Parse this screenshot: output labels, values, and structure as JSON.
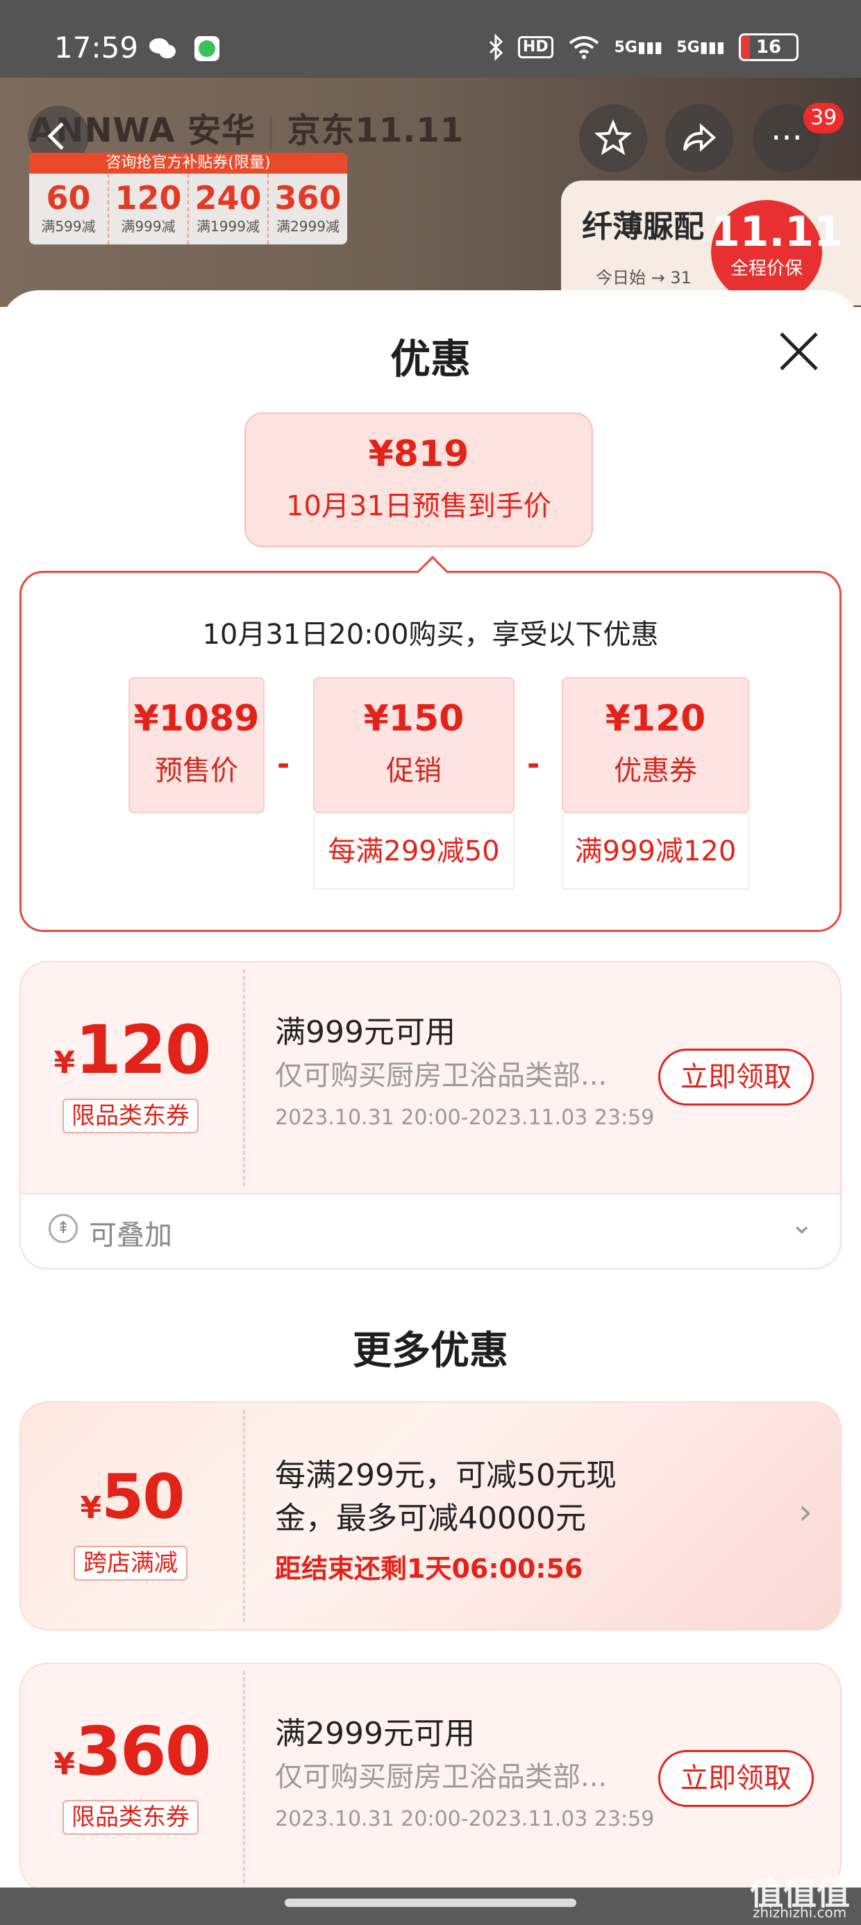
{
  "status_bar": {
    "time": "17:59",
    "hd_label": "HD",
    "net1": "5G",
    "net2": "5G",
    "battery": "16"
  },
  "background": {
    "brand": "ANNWA 安华",
    "brand_partner": "京东11.11",
    "coupon_strip": {
      "header": "咨询抢官方补贴券(限量)",
      "items": [
        {
          "amount": "60",
          "cond": "满599减"
        },
        {
          "amount": "120",
          "cond": "满999减"
        },
        {
          "amount": "240",
          "cond": "满1999减"
        },
        {
          "amount": "360",
          "cond": "满2999减"
        }
      ]
    },
    "promo_title": "纤薄脲配",
    "promo_sub": "今日始  →  31",
    "badge_count": "39",
    "eleven_big": "11.11",
    "eleven_small": "全程价保"
  },
  "sheet": {
    "title": "优惠",
    "final_price": {
      "price": "¥819",
      "label": "10月31日预售到手价"
    },
    "breakdown": {
      "text": "10月31日20:00购买，享受以下优惠",
      "items": [
        {
          "value": "¥1089",
          "label": "预售价",
          "sub": ""
        },
        {
          "value": "¥150",
          "label": "促销",
          "sub": "每满299减50"
        },
        {
          "value": "¥120",
          "label": "优惠券",
          "sub": "满999减120"
        }
      ],
      "minus": "-"
    },
    "coupon1": {
      "currency": "¥",
      "amount": "120",
      "tag": "限品类东券",
      "title": "满999元可用",
      "desc": "仅可购买厨房卫浴品类部...",
      "date": "2023.10.31 20:00-2023.11.03 23:59",
      "button": "立即领取"
    },
    "stack_label": "可叠加",
    "more_title": "更多优惠",
    "coupon2": {
      "currency": "¥",
      "amount": "50",
      "tag": "跨店满减",
      "title_line1": "每满299元，可减50元现",
      "title_line2": "金，最多可减40000元",
      "countdown": "距结束还剩1天06:00:56"
    },
    "coupon3": {
      "currency": "¥",
      "amount": "360",
      "tag": "限品类东券",
      "title": "满2999元可用",
      "desc": "仅可购买厨房卫浴品类部...",
      "date": "2023.10.31 20:00-2023.11.03 23:59",
      "button": "立即领取"
    }
  },
  "watermark": {
    "text": "值值值",
    "sub": "zhizhizhi.com"
  },
  "colors": {
    "accent": "#e2231a",
    "coupon_bg": "#fff2f0"
  }
}
